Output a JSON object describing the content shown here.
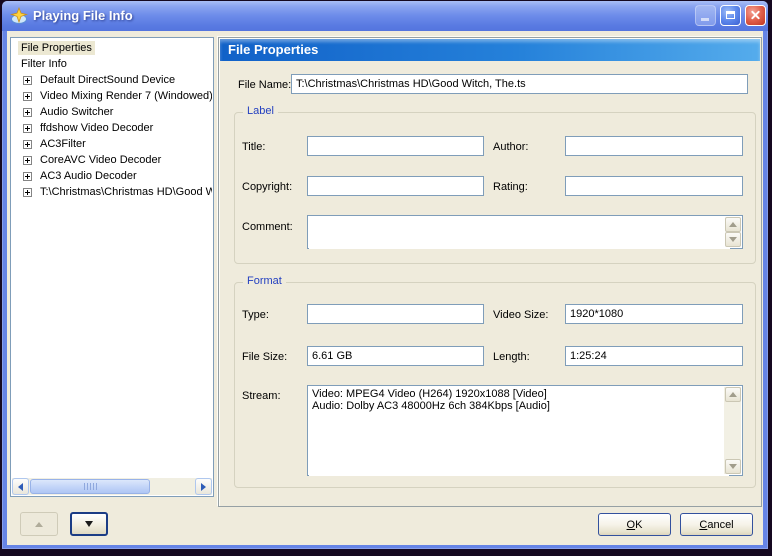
{
  "window": {
    "title": "Playing File Info"
  },
  "icons": {
    "app_icon": "star-swirl",
    "minimize_icon": "underscore",
    "maximize_icon": "square",
    "close_icon": "x",
    "tree_expand_icon": "plus-box",
    "scroll_icons": [
      "left-arrow",
      "right-arrow",
      "up-arrow",
      "down-arrow"
    ]
  },
  "tree": {
    "items": [
      {
        "label": "File Properties",
        "selected": true,
        "expandable": false
      },
      {
        "label": "Filter Info",
        "selected": false,
        "expandable": false
      },
      {
        "label": "Default DirectSound Device",
        "selected": false,
        "expandable": true
      },
      {
        "label": "Video Mixing Render 7 (Windowed)",
        "selected": false,
        "expandable": true
      },
      {
        "label": "Audio Switcher",
        "selected": false,
        "expandable": true
      },
      {
        "label": "ffdshow Video Decoder",
        "selected": false,
        "expandable": true
      },
      {
        "label": "AC3Filter",
        "selected": false,
        "expandable": true
      },
      {
        "label": "CoreAVC Video Decoder",
        "selected": false,
        "expandable": true
      },
      {
        "label": "AC3 Audio Decoder",
        "selected": false,
        "expandable": true
      },
      {
        "label": "T:\\Christmas\\Christmas HD\\Good Wi",
        "selected": false,
        "expandable": true
      }
    ]
  },
  "panel": {
    "header": "File Properties",
    "file_name": {
      "label": "File Name:",
      "value": "T:\\Christmas\\Christmas HD\\Good Witch, The.ts"
    },
    "label_group": {
      "legend": "Label",
      "title_label": "Title:",
      "title_value": "",
      "author_label": "Author:",
      "author_value": "",
      "copyright_label": "Copyright:",
      "copyright_value": "",
      "rating_label": "Rating:",
      "rating_value": "",
      "comment_label": "Comment:",
      "comment_value": ""
    },
    "format_group": {
      "legend": "Format",
      "type_label": "Type:",
      "type_value": "",
      "video_size_label": "Video Size:",
      "video_size_value": "1920*1080",
      "file_size_label": "File Size:",
      "file_size_value": "6.61 GB",
      "length_label": "Length:",
      "length_value": "1:25:24",
      "stream_label": "Stream:",
      "stream_value": "Video: MPEG4 Video (H264) 1920x1088 [Video]\nAudio: Dolby AC3 48000Hz 6ch 384Kbps [Audio]"
    }
  },
  "buttons": {
    "ok": "OK",
    "cancel": "Cancel"
  },
  "colors": {
    "dialog_bg": "#EFEBDC",
    "titlebar_blue": "#6D8CEA",
    "header_blue": "#1161C8",
    "input_border": "#7F9DB9",
    "close_red": "#C33823",
    "legend_blue": "#2440C0"
  }
}
